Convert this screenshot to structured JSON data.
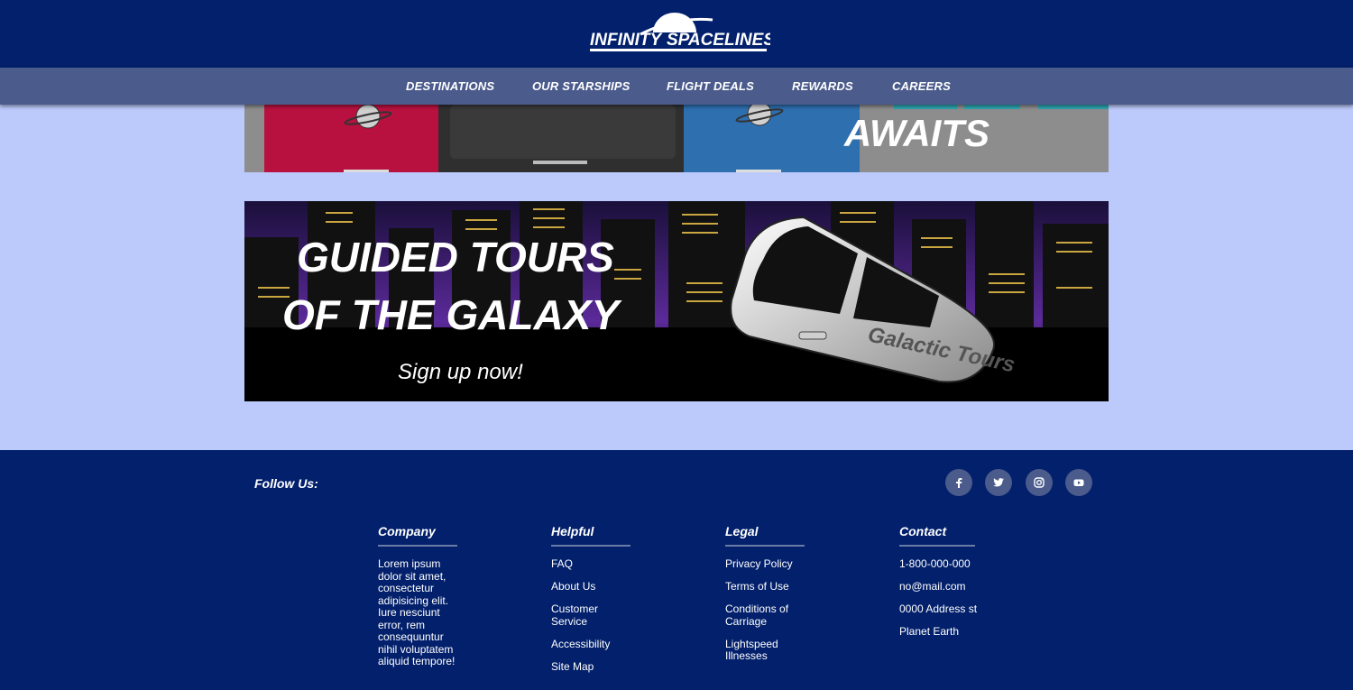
{
  "brand": {
    "logo_text_1": "INFINITY",
    "logo_text_2": "SPACELINES"
  },
  "nav": {
    "items": [
      {
        "label": "DESTINATIONS"
      },
      {
        "label": "OUR STARSHIPS"
      },
      {
        "label": "FLIGHT DEALS"
      },
      {
        "label": "REWARDS"
      },
      {
        "label": "CAREERS"
      }
    ]
  },
  "promo_luggage": {
    "headline": "AWAITS"
  },
  "promo_tours": {
    "line1": "GUIDED TOURS",
    "line2": "OF THE GALAXY",
    "cta": "Sign up now!",
    "bus_text": "Galactic Tours"
  },
  "footer": {
    "follow_label": "Follow Us:",
    "social": [
      "facebook-icon",
      "twitter-icon",
      "instagram-icon",
      "youtube-icon"
    ],
    "company": {
      "title": "Company",
      "text": "Lorem ipsum dolor sit amet, consectetur adipisicing elit. Iure nesciunt error, rem consequuntur nihil voluptatem aliquid tempore!"
    },
    "helpful": {
      "title": "Helpful",
      "links": [
        "FAQ",
        "About Us",
        "Customer Service",
        "Accessibility",
        "Site Map"
      ]
    },
    "legal": {
      "title": "Legal",
      "links": [
        "Privacy Policy",
        "Terms of Use",
        "Conditions of Carriage",
        "Lightspeed Illnesses"
      ]
    },
    "contact": {
      "title": "Contact",
      "items": [
        "1-800-000-000",
        "no@mail.com",
        "0000 Address st",
        "Planet Earth"
      ]
    }
  },
  "colors": {
    "header_bg": "#02206b",
    "nav_bg": "#4a5b8c",
    "page_bg": "#bcc9fb",
    "footer_bg": "#02206b"
  }
}
